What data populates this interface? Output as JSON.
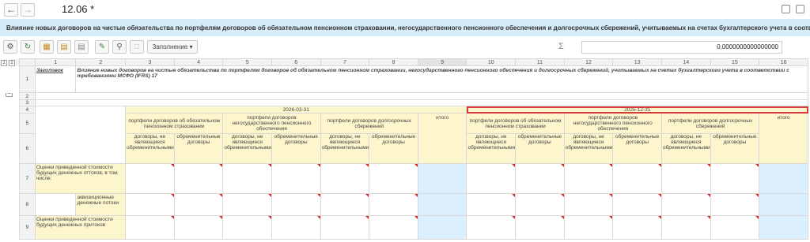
{
  "window": {
    "back_icon": "arrow-left-icon",
    "forward_icon": "arrow-right-icon",
    "title": "12.06 *"
  },
  "header": {
    "title": "Влияние новых договоров на чистые обязательства по портфелям договоров об обязательном пенсионном страховании, негосударственного пенсионного обеспечения и долгосрочных сбережений, учитываемых на счетах бухгалтерского учета в соотв..."
  },
  "toolbar": {
    "fill_label": "Заполнение",
    "sigma": "Σ",
    "sum_value": "0,0000000000000000"
  },
  "grid": {
    "levels": [
      "1",
      "2"
    ],
    "columns": [
      "1",
      "2",
      "3",
      "4",
      "5",
      "6",
      "7",
      "8",
      "9",
      "10",
      "11",
      "12",
      "13",
      "14",
      "15",
      "16"
    ],
    "rows": [
      "1",
      "2",
      "3",
      "4",
      "5",
      "6",
      "7",
      "8",
      "9"
    ],
    "title_label": "Заголовок",
    "title_text": "Влияние новых договоров на чистые обязательства по портфелям договоров об обязательном пенсионном страховании, негосударственного пенсионного обеспечения и долгосрочных сбережений, учитываемых на счетах бухгалтерского учета в соответствии с требованиями МСФО (IFRS) 17",
    "date1": "2026-03-31",
    "date2": "2025-12-31",
    "portfolios": [
      "портфели договоров об обязательном пенсионном страховании",
      "портфели договоров негосударственного пенсионного обеспечения",
      "портфели договоров долгосрочных сбережений"
    ],
    "total": "итого",
    "sub_non_onerous": "договоры, не являющиеся обременительными",
    "sub_onerous": "обременительные договоры",
    "row7_label": "Оценки приведенной стоимости будущих денежных оттоков, в том числе:",
    "row8_label": "аквизиционные денежные потоки",
    "row9_label": "Оценки приведенной стоимости будущих денежных притоков"
  },
  "colors": {
    "header_bg": "#d6ecf8",
    "yellow": "#fdf5cc",
    "light_blue": "#dcefff",
    "red_border": "#d43a3a"
  }
}
